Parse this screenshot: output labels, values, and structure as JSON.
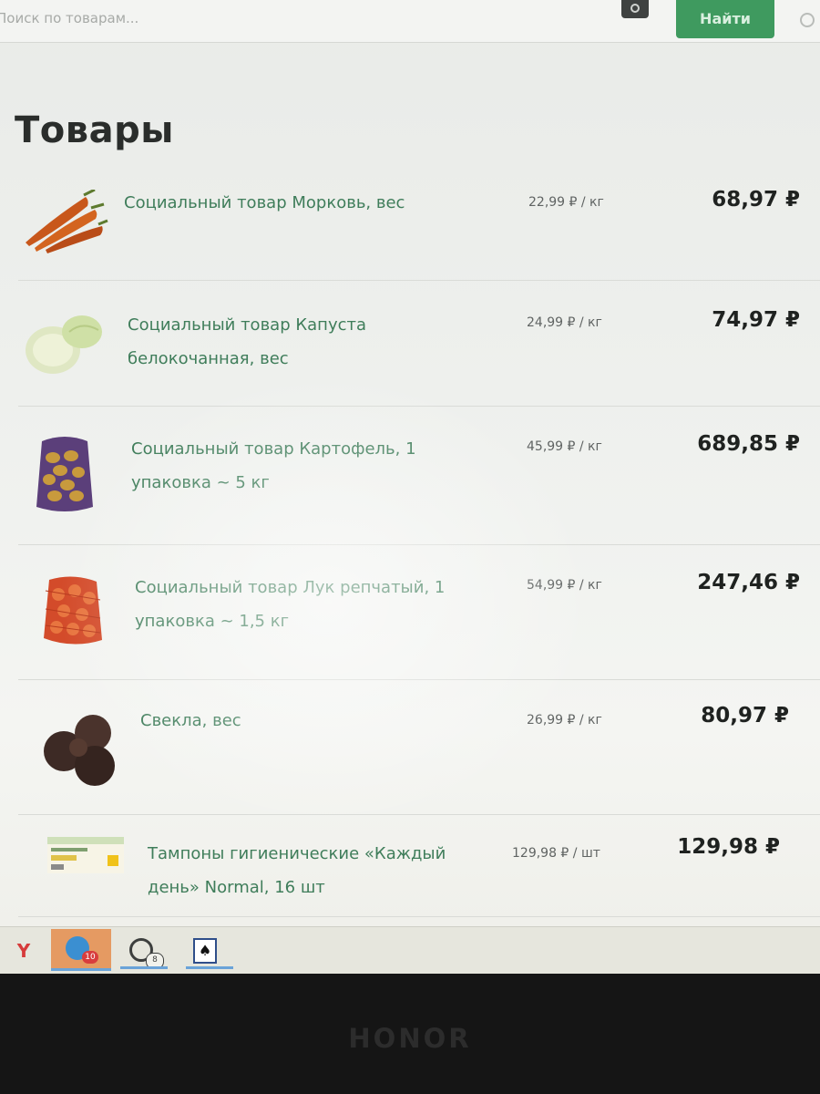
{
  "search": {
    "placeholder": "Поиск по товарам...",
    "button_label": "Найти"
  },
  "section_title": "Товары",
  "items": [
    {
      "name": "Социальный товар Морковь, вес",
      "unit_price": "22,99 ₽ / кг",
      "total": "68,97 ₽",
      "icon": "carrot-image"
    },
    {
      "name": "Социальный товар Капуста белокочанная, вес",
      "unit_price": "24,99 ₽ / кг",
      "total": "74,97 ₽",
      "icon": "cabbage-image"
    },
    {
      "name": "Социальный товар Картофель, 1 упаковка ~ 5 кг",
      "unit_price": "45,99 ₽ / кг",
      "total": "689,85 ₽",
      "icon": "potato-bag-image"
    },
    {
      "name": "Социальный товар Лук репчатый, 1 упаковка ~ 1,5 кг",
      "unit_price": "54,99 ₽ / кг",
      "total": "247,46 ₽",
      "icon": "onion-bag-image"
    },
    {
      "name": "Свекла, вес",
      "unit_price": "26,99 ₽ / кг",
      "total": "80,97 ₽",
      "icon": "beet-image"
    },
    {
      "name": "Тампоны гигиенические «Каждый день» Normal, 16 шт",
      "unit_price": "129,98 ₽ / шт",
      "total": "129,98 ₽",
      "icon": "tampon-box-image"
    }
  ],
  "taskbar": {
    "yandex_label": "Y",
    "telegram_badge": "10",
    "whatsapp_badge": "8",
    "solitaire_label": "♠"
  },
  "device_brand": "HONOR",
  "colors": {
    "accent_green": "#3f9a5f",
    "item_name": "#3f7d5a"
  }
}
